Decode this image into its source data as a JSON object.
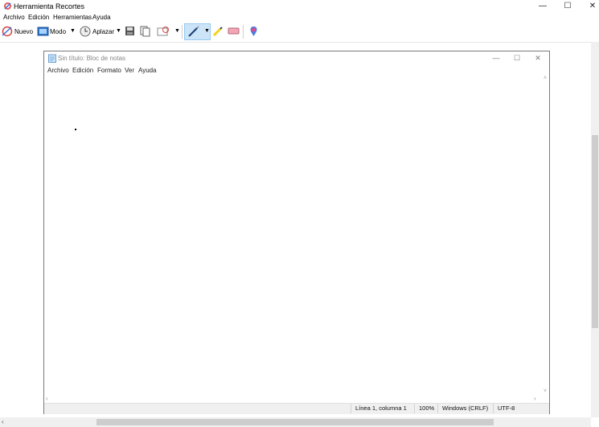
{
  "window": {
    "title": "Herramienta Recortes",
    "controls": {
      "minimize": "—",
      "maximize": "☐",
      "close": "✕"
    }
  },
  "menu": [
    "Archivo",
    "Edición",
    "Herramientas",
    "Ayuda"
  ],
  "toolbar": {
    "new_label": "Nuevo",
    "mode_label": "Modo",
    "delay_label": "Aplazar",
    "icons": [
      "new-snip-icon",
      "mode-icon",
      "delay-clock-icon",
      "save-icon",
      "copy-icon",
      "send-icon",
      "pen-icon",
      "highlighter-icon",
      "eraser-icon",
      "paint3d-icon"
    ]
  },
  "notepad": {
    "title": "Sin título: Bloc de notas",
    "controls": {
      "minimize": "—",
      "maximize": "☐",
      "close": "✕"
    },
    "menu": [
      "Archivo",
      "Edición",
      "Formato",
      "Ver",
      "Ayuda"
    ],
    "content": "",
    "status": {
      "position": "Línea 1, columna 1",
      "zoom": "100%",
      "line_ending": "Windows (CRLF)",
      "encoding": "UTF-8"
    }
  },
  "colors": {
    "accent_active": "#cce4f7",
    "border": "#7a7a7a"
  }
}
